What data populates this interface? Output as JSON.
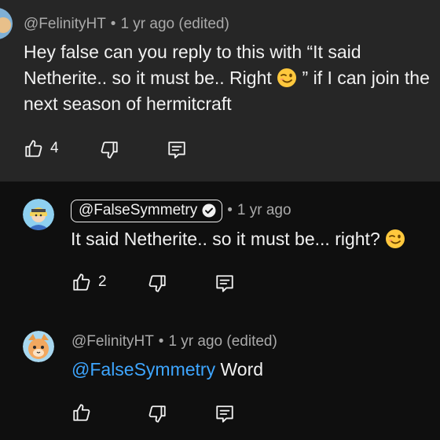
{
  "comment1": {
    "handle": "@FelinityHT",
    "time": "1 yr ago (edited)",
    "text_part1": "Hey false can you reply to this with “It said Netherite.. so it must be.. Right",
    "text_part2": "” if I can join the next season of hermitcraft",
    "emoji": "winking-face",
    "likes": "4"
  },
  "reply1": {
    "handle": "@FalseSymmetry",
    "time": "1 yr ago",
    "text": "It said Netherite.. so it must be... right?",
    "emoji": "winking-face",
    "likes": "2"
  },
  "reply2": {
    "handle": "@FelinityHT",
    "time": "1 yr ago (edited)",
    "mention": "@FalseSymmetry",
    "text": "Word"
  },
  "separator": "•",
  "colors": {
    "background": "#0f0f0f",
    "highlight": "#262626",
    "mention": "#3ea6ff",
    "meta": "#aaaaaa"
  }
}
